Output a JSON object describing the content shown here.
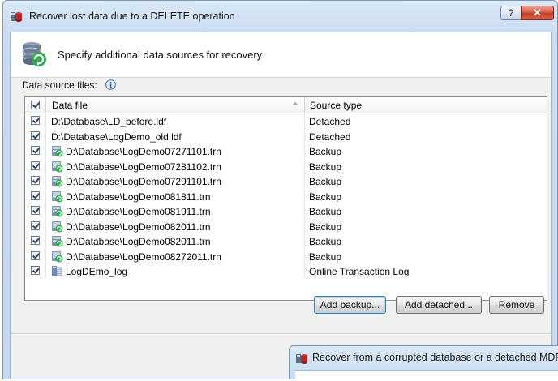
{
  "dialog": {
    "title": "Recover lost data due to a DELETE operation",
    "help_label": "?",
    "close_label": "✕",
    "header": "Specify additional data sources for recovery",
    "data_source_label": "Data source files:"
  },
  "grid": {
    "columns": {
      "file": "Data file",
      "source": "Source type"
    },
    "rows": [
      {
        "file": "D:\\Database\\LD_before.ldf",
        "source": "Detached",
        "icon": "none",
        "checked": true
      },
      {
        "file": "D:\\Database\\LogDemo_old.ldf",
        "source": "Detached",
        "icon": "none",
        "checked": true
      },
      {
        "file": "D:\\Database\\LogDemo07271101.trn",
        "source": "Backup",
        "icon": "backup-icon",
        "checked": true
      },
      {
        "file": "D:\\Database\\LogDemo07281102.trn",
        "source": "Backup",
        "icon": "backup-icon",
        "checked": true
      },
      {
        "file": "D:\\Database\\LogDemo07291101.trn",
        "source": "Backup",
        "icon": "backup-icon",
        "checked": true
      },
      {
        "file": "D:\\Database\\LogDemo081811.trn",
        "source": "Backup",
        "icon": "backup-icon",
        "checked": true
      },
      {
        "file": "D:\\Database\\LogDemo081911.trn",
        "source": "Backup",
        "icon": "backup-icon",
        "checked": true
      },
      {
        "file": "D:\\Database\\LogDemo082011.trn",
        "source": "Backup",
        "icon": "backup-icon",
        "checked": true
      },
      {
        "file": "D:\\Database\\LogDemo082011.trn",
        "source": "Backup",
        "icon": "backup-icon",
        "checked": true
      },
      {
        "file": "D:\\Database\\LogDemo08272011.trn",
        "source": "Backup",
        "icon": "backup-icon",
        "checked": true
      },
      {
        "file": "LogDEmo_log",
        "source": "Online Transaction Log",
        "icon": "transaction-log-icon",
        "checked": true
      }
    ]
  },
  "buttons": {
    "add_backup": "Add backup...",
    "add_detached": "Add detached...",
    "remove": "Remove"
  },
  "second_window": {
    "title": "Recover from a corrupted database or a detached MDF file"
  }
}
